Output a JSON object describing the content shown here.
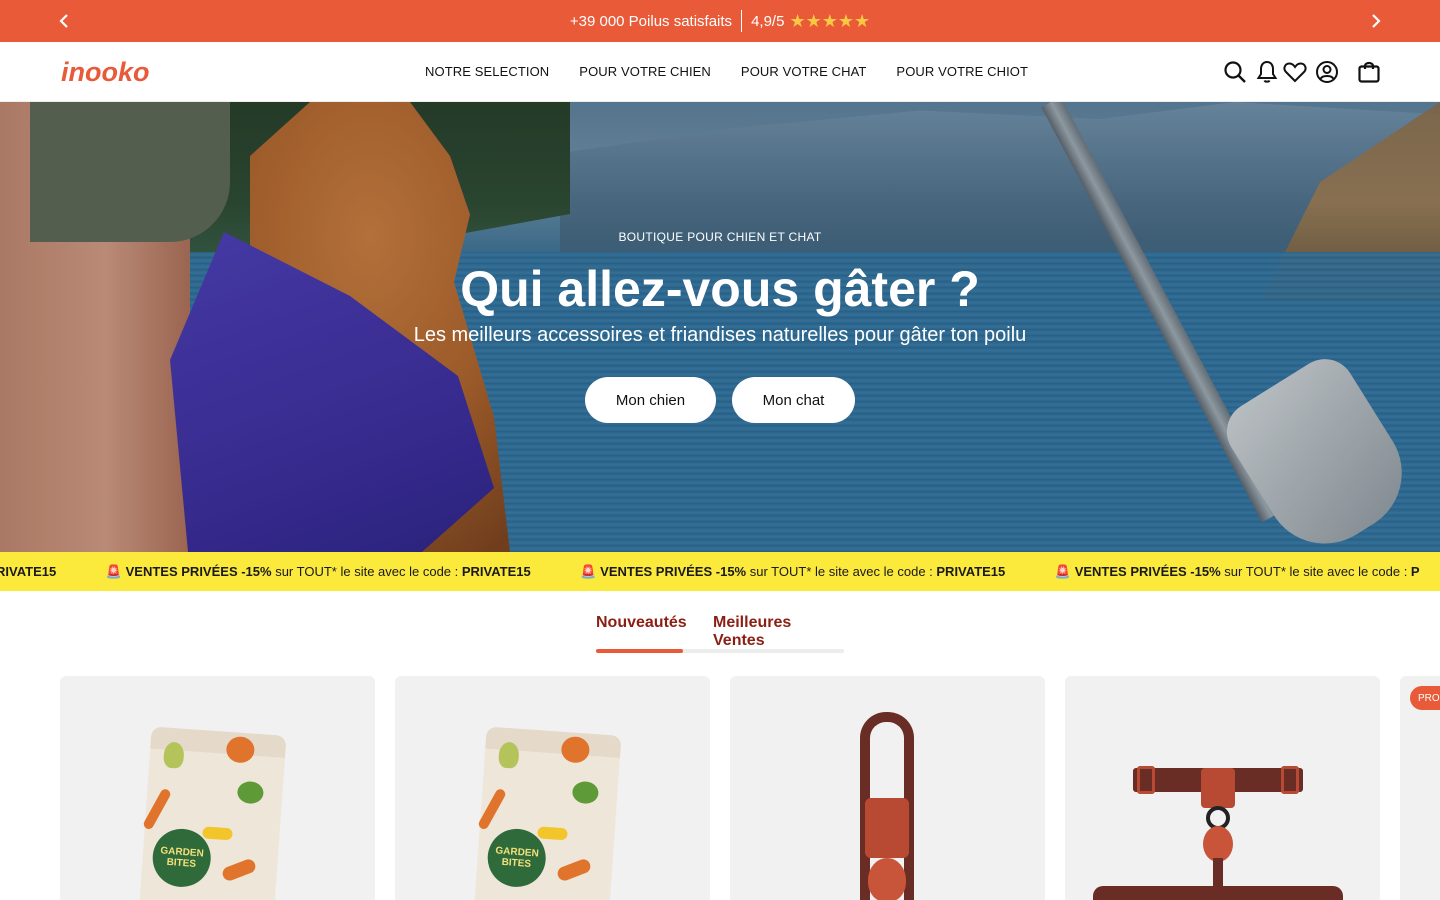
{
  "announcement": {
    "satisfied": "+39 000 Poilus satisfaits",
    "rating": "4,9/5",
    "stars": "★★★★★",
    "background": "#e85a38"
  },
  "header": {
    "logo_text": "inooko",
    "nav": [
      {
        "label": "NOTRE SELECTION"
      },
      {
        "label": "POUR VOTRE CHIEN"
      },
      {
        "label": "POUR VOTRE CHAT"
      },
      {
        "label": "POUR VOTRE CHIOT"
      }
    ],
    "icons": [
      "search-icon",
      "bell-icon",
      "heart-icon",
      "account-icon",
      "cart-icon"
    ]
  },
  "hero": {
    "kicker": "BOUTIQUE POUR CHIEN ET CHAT",
    "title": "Qui allez-vous gâter ?",
    "subtitle": "Les meilleurs accessoires et friandises naturelles pour gâter ton poilu",
    "buttons": [
      {
        "label": "Mon chien"
      },
      {
        "label": "Mon chat"
      }
    ]
  },
  "promo": {
    "lead_fragment": "RIVATE15",
    "emoji": "🚨",
    "headline": "VENTES PRIVÉES -15%",
    "text": " sur TOUT* le site avec le code : ",
    "code": "PRIVATE15",
    "tail_fragment": "P",
    "background": "#fbe93c"
  },
  "tabs": [
    {
      "label": "Nouveautés",
      "active": true
    },
    {
      "label": "Meilleures Ventes",
      "active": false
    }
  ],
  "products": [
    {
      "kind": "food-bag",
      "pack_text": "GARDEN BITES"
    },
    {
      "kind": "food-bag",
      "pack_text": "GARDEN BITES"
    },
    {
      "kind": "collar"
    },
    {
      "kind": "harness"
    },
    {
      "kind": "leash",
      "badge": "PROM"
    }
  ],
  "colors": {
    "accent": "#e85a38",
    "tab_text": "#8a1f13"
  }
}
